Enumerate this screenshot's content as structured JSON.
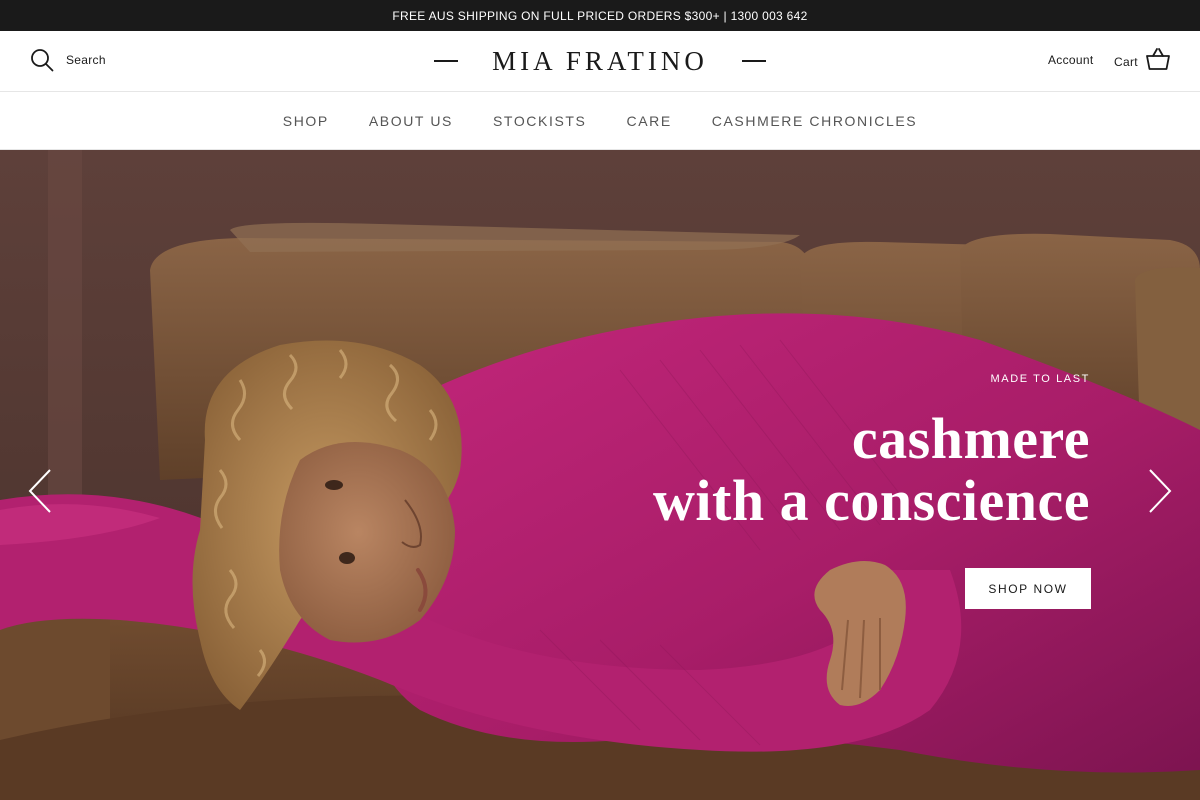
{
  "announcement": {
    "text": "FREE AUS SHIPPING ON FULL PRICED ORDERS $300+ | 1300 003 642"
  },
  "header": {
    "search_label": "Search",
    "logo_text": "MIA FRATINO",
    "account_label": "Account",
    "cart_label": "Cart",
    "icons": {
      "search": "search-icon",
      "cart": "basket-icon"
    }
  },
  "nav": {
    "items": [
      {
        "label": "SHOP"
      },
      {
        "label": "ABOUT US"
      },
      {
        "label": "STOCKISTS"
      },
      {
        "label": "CARE"
      },
      {
        "label": "CASHMERE CHRONICLES"
      }
    ]
  },
  "hero": {
    "eyebrow": "MADE TO LAST",
    "title_line1": "cashmere",
    "title_line2": "with a conscience",
    "cta_label": "SHOP NOW",
    "prev_icon": "chevron-left-icon",
    "next_icon": "chevron-right-icon"
  },
  "colors": {
    "announcement_bg": "#1a1a1a",
    "text": "#1a1a1a",
    "nav_text": "#555555",
    "sweater_magenta": "#b01e6e",
    "sofa_leather": "#7a5538",
    "wall": "#553a34"
  }
}
